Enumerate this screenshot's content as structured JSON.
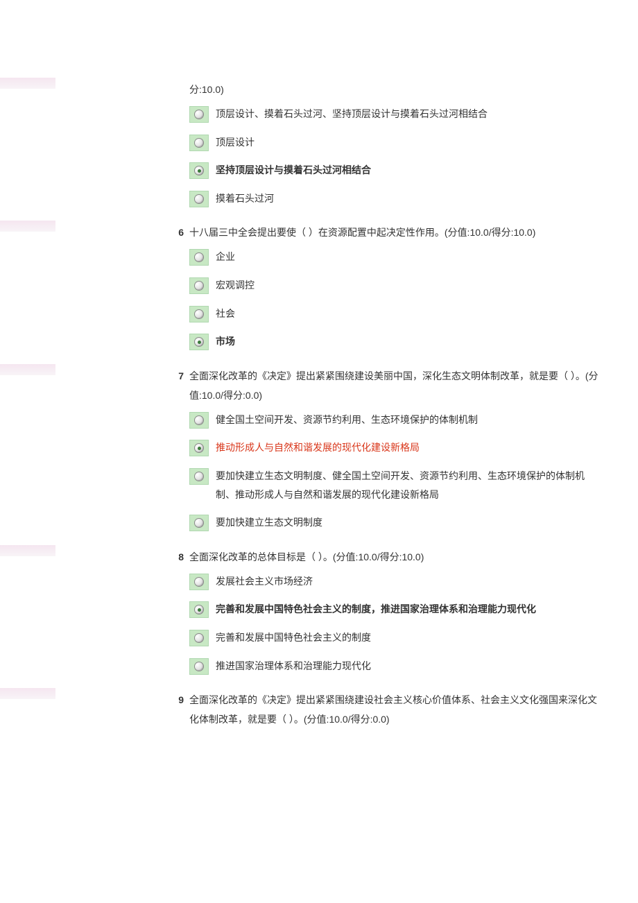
{
  "questions": [
    {
      "number": "",
      "stem": "分:10.0)",
      "hasHeaderBg": true,
      "options": [
        {
          "text": "顶层设计、摸着石头过河、坚持顶层设计与摸着石头过河相结合",
          "selected": false,
          "wrong": false
        },
        {
          "text": "顶层设计",
          "selected": false,
          "wrong": false
        },
        {
          "text": "坚持顶层设计与摸着石头过河相结合",
          "selected": true,
          "wrong": false
        },
        {
          "text": "摸着石头过河",
          "selected": false,
          "wrong": false
        }
      ]
    },
    {
      "number": "6",
      "stem": "十八届三中全会提出要使（  ）在资源配置中起决定性作用。(分值:10.0/得分:10.0)",
      "hasHeaderBg": true,
      "options": [
        {
          "text": "企业",
          "selected": false,
          "wrong": false
        },
        {
          "text": "宏观调控",
          "selected": false,
          "wrong": false
        },
        {
          "text": "社会",
          "selected": false,
          "wrong": false
        },
        {
          "text": "市场",
          "selected": true,
          "wrong": false
        }
      ]
    },
    {
      "number": "7",
      "stem": "全面深化改革的《决定》提出紧紧围绕建设美丽中国，深化生态文明体制改革，就是要（  ）。(分值:10.0/得分:0.0)",
      "hasHeaderBg": true,
      "options": [
        {
          "text": "健全国土空间开发、资源节约利用、生态环境保护的体制机制",
          "selected": false,
          "wrong": false
        },
        {
          "text": "推动形成人与自然和谐发展的现代化建设新格局",
          "selected": true,
          "wrong": true
        },
        {
          "text": "要加快建立生态文明制度、健全国土空间开发、资源节约利用、生态环境保护的体制机制、推动形成人与自然和谐发展的现代化建设新格局",
          "selected": false,
          "wrong": false
        },
        {
          "text": "要加快建立生态文明制度",
          "selected": false,
          "wrong": false
        }
      ]
    },
    {
      "number": "8",
      "stem": "全面深化改革的总体目标是（  ）。(分值:10.0/得分:10.0)",
      "hasHeaderBg": true,
      "options": [
        {
          "text": "发展社会主义市场经济",
          "selected": false,
          "wrong": false
        },
        {
          "text": "完善和发展中国特色社会主义的制度，推进国家治理体系和治理能力现代化",
          "selected": true,
          "wrong": false
        },
        {
          "text": "完善和发展中国特色社会主义的制度",
          "selected": false,
          "wrong": false
        },
        {
          "text": "推进国家治理体系和治理能力现代化",
          "selected": false,
          "wrong": false
        }
      ]
    },
    {
      "number": "9",
      "stem": "全面深化改革的《决定》提出紧紧围绕建设社会主义核心价值体系、社会主义文化强国来深化文化体制改革，就是要（  ）。(分值:10.0/得分:0.0)",
      "hasHeaderBg": true,
      "options": []
    }
  ]
}
